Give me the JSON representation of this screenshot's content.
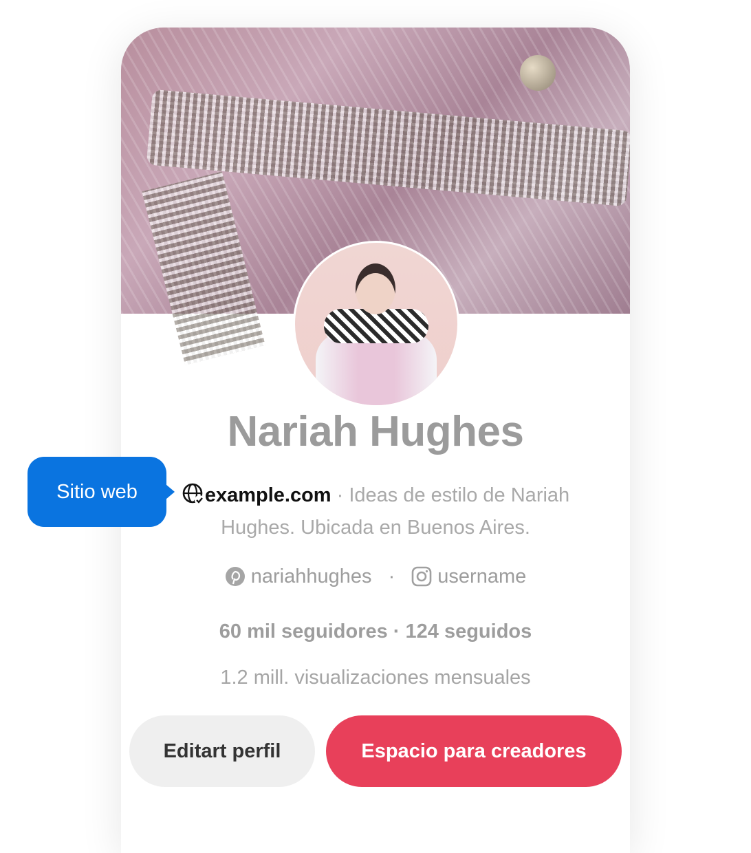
{
  "profile": {
    "name": "Nariah Hughes",
    "website": "example.com",
    "bio_separator": " · ",
    "bio": "Ideas de estilo de Nariah Hughes. Ubicada en Buenos Aires.",
    "pinterest_handle": "nariahhughes",
    "instagram_handle": "username",
    "stats": "60 mil seguidores · 124 seguidos",
    "monthly_views": "1.2 mill. visualizaciones mensuales"
  },
  "buttons": {
    "edit_profile": "Editart perfil",
    "creator_hub": "Espacio para creadores"
  },
  "tooltip": {
    "label": "Sitio web"
  },
  "icons": {
    "website": "globe-check-icon",
    "pinterest": "pinterest-icon",
    "instagram": "instagram-icon"
  },
  "colors": {
    "primary_button": "#e8405a",
    "secondary_button": "#efefef",
    "tooltip": "#0a74e0",
    "muted_text": "#a9a9a9"
  }
}
